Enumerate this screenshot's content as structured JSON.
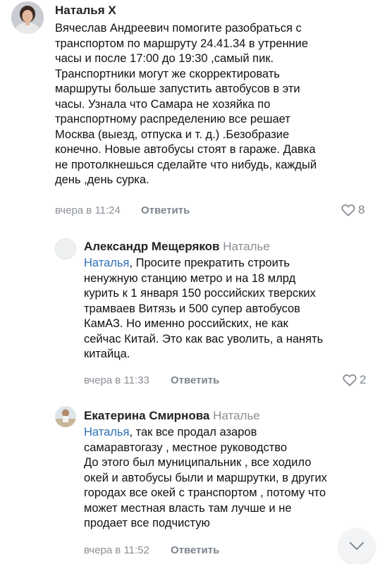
{
  "comments": [
    {
      "author": "Наталья Х",
      "lines": [
        "Вячеслав Андреевич помогите разобраться с",
        "транспортом по маршруту 24.41.34 в утренние",
        "часы и после 17:00 до 19:30 ,самый пик.",
        "Транспортники могут же скорректировать",
        "маршруты больше запустить автобусов в эти",
        "часы. Узнала что Самара не хозяйка по",
        "транспортному распределению все решает",
        "Москва (выезд, отпуска и т. д.) .Безобразие",
        "конечно. Новые автобусы стоят в гараже. Давка",
        "не протолкнешься сделайте что нибудь, каждый",
        "день ,день сурка."
      ],
      "time": "вчера в 11:24",
      "reply_label": "Ответить",
      "likes": "8"
    },
    {
      "author": "Александр Мещеряков",
      "reply_to": "Наталье",
      "mention": "Наталья",
      "first_line_rest": ", Просите прекратить строить",
      "lines": [
        "ненужную станцию метро и на 18 млрд",
        "курить к 1 января 150 российских тверских",
        "трамваев Витязь и 500 супер автобусов",
        "КамАЗ. Но именно российских, не как",
        "сейчас Китай. Это как вас уволить, а нанять",
        "китайца."
      ],
      "time": "вчера в 11:33",
      "reply_label": "Ответить",
      "likes": "2"
    },
    {
      "author": "Екатерина Смирнова",
      "reply_to": "Наталье",
      "mention": "Наталья",
      "first_line_rest": ", так все продал азаров",
      "lines": [
        "самаравтогазу , местное руководство",
        "До этого был муниципальник , все ходило",
        "окей и автобусы были и маршрутки, в других",
        "городах все окей с транспортом , потому что",
        "может местная власть там лучше и не",
        "продает все подчистую"
      ],
      "time": "вчера в 11:52",
      "reply_label": "Ответить"
    }
  ],
  "colors": {
    "mention": "#2f6fb3",
    "muted": "#8a8f96",
    "text": "#111111"
  },
  "icons": {
    "like": "heart-icon",
    "scroll": "chevron-down-icon"
  }
}
